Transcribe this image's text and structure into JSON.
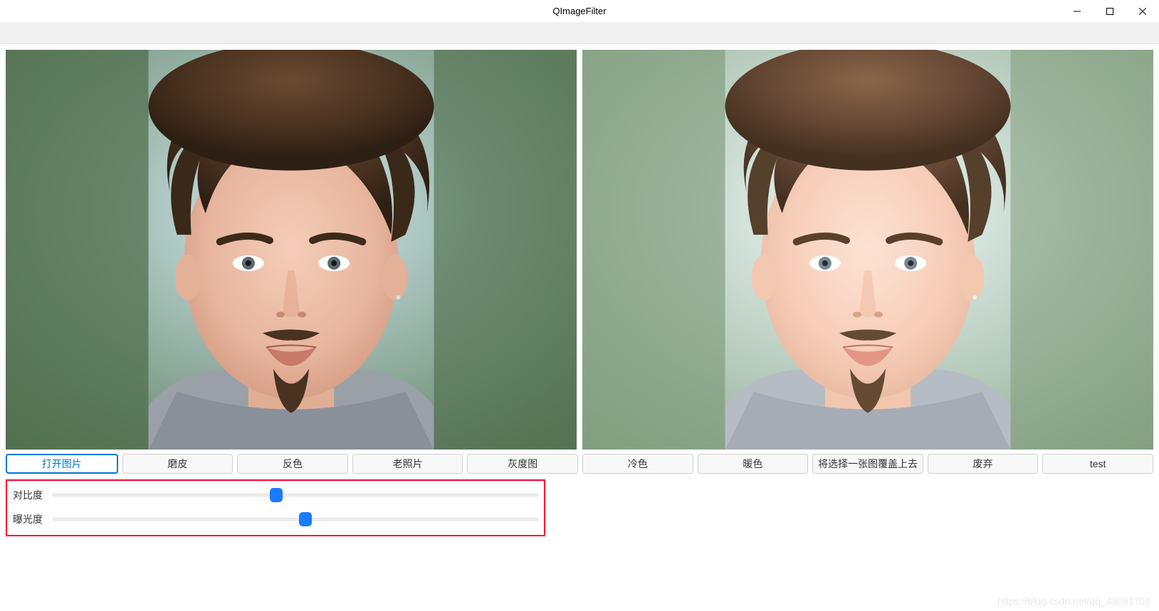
{
  "window": {
    "title": "QImageFilter"
  },
  "buttons": [
    {
      "label": "打开图片",
      "active": true
    },
    {
      "label": "磨皮",
      "active": false
    },
    {
      "label": "反色",
      "active": false
    },
    {
      "label": "老照片",
      "active": false
    },
    {
      "label": "灰度图",
      "active": false
    },
    {
      "label": "冷色",
      "active": false
    },
    {
      "label": "暖色",
      "active": false
    },
    {
      "label": "将选择一张图覆盖上去",
      "active": false
    },
    {
      "label": "废弃",
      "active": false
    },
    {
      "label": "test",
      "active": false
    }
  ],
  "sliders": {
    "contrast": {
      "label": "对比度",
      "value": 46
    },
    "exposure": {
      "label": "曝光度",
      "value": 52
    }
  },
  "watermark": "https://blog.csdn.net/qq_43081702"
}
